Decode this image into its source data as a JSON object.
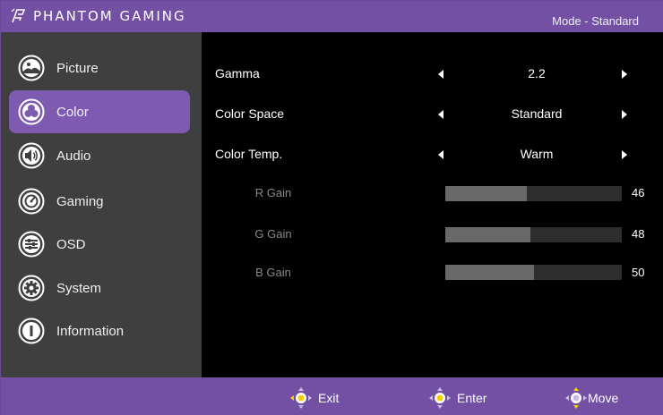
{
  "header": {
    "brand": "PHANTOM GAMING",
    "mode": "Mode - Standard"
  },
  "sidebar": {
    "items": [
      {
        "label": "Picture",
        "icon": "picture-icon",
        "active": false
      },
      {
        "label": "Color",
        "icon": "color-icon",
        "active": true
      },
      {
        "label": "Audio",
        "icon": "audio-icon",
        "active": false
      },
      {
        "label": "Gaming",
        "icon": "gaming-icon",
        "active": false
      },
      {
        "label": "OSD",
        "icon": "osd-icon",
        "active": false
      },
      {
        "label": "System",
        "icon": "system-icon",
        "active": false
      },
      {
        "label": "Information",
        "icon": "information-icon",
        "active": false
      }
    ]
  },
  "settings": {
    "gamma": {
      "label": "Gamma",
      "value": "2.2"
    },
    "color_space": {
      "label": "Color Space",
      "value": "Standard"
    },
    "color_temp": {
      "label": "Color Temp.",
      "value": "Warm"
    }
  },
  "gains": {
    "r": {
      "label": "R Gain",
      "value": 46,
      "display": "46"
    },
    "g": {
      "label": "G Gain",
      "value": 48,
      "display": "48"
    },
    "b": {
      "label": "B Gain",
      "value": 50,
      "display": "50"
    },
    "max": 100
  },
  "footer": {
    "exit": "Exit",
    "enter": "Enter",
    "move": "Move"
  },
  "colors": {
    "accent": "#7350a3",
    "active_item": "#7e5bb0",
    "sidebar_bg": "#3f3f3f",
    "joystick_dot": "#f5d000"
  }
}
